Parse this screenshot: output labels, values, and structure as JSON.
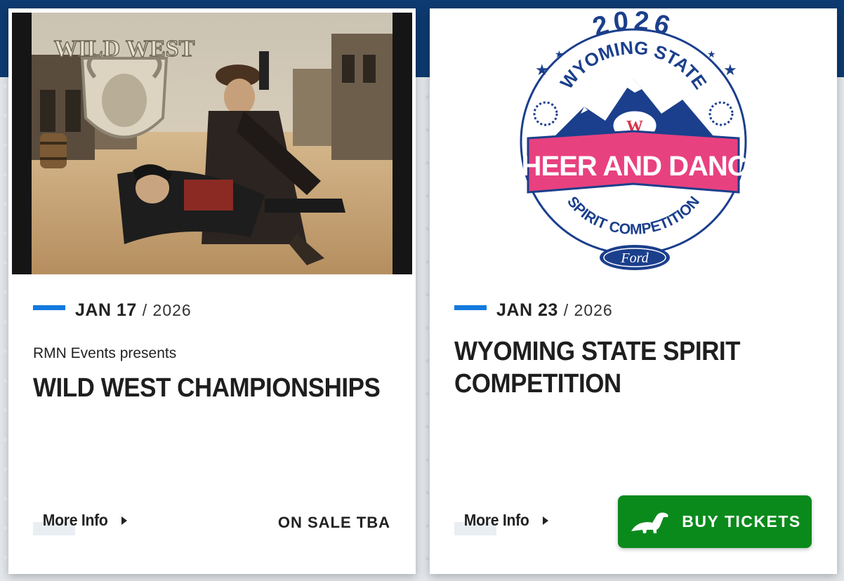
{
  "colors": {
    "accent_blue": "#1279de",
    "header_navy": "#0d3a70",
    "buy_green": "#0b8a1c",
    "logo_pink": "#e8417f",
    "logo_navy": "#1b3f8c"
  },
  "events": [
    {
      "image": {
        "logo_text": "WILD WEST",
        "icon": "wild-west-illustration"
      },
      "date": "JAN 17",
      "year_sep": "/ 2026",
      "presenter": "RMN Events presents",
      "title": "WILD WEST CHAMPIONSHIPS",
      "more_info_label": "More Info",
      "status": "ON SALE TBA"
    },
    {
      "image": {
        "logo_year": "2026",
        "logo_state": "WYOMING STATE",
        "logo_main": "CHEER AND DANCE",
        "logo_sub": "SPIRIT COMPETITION",
        "logo_sponsor": "Ford",
        "icon": "cheer-dance-logo"
      },
      "date": "JAN 23",
      "year_sep": "/ 2026",
      "title": "WYOMING STATE SPIRIT COMPETITION",
      "more_info_label": "More Info",
      "buy_label": "BUY TICKETS",
      "buy_icon": "dinosaur-icon"
    }
  ]
}
